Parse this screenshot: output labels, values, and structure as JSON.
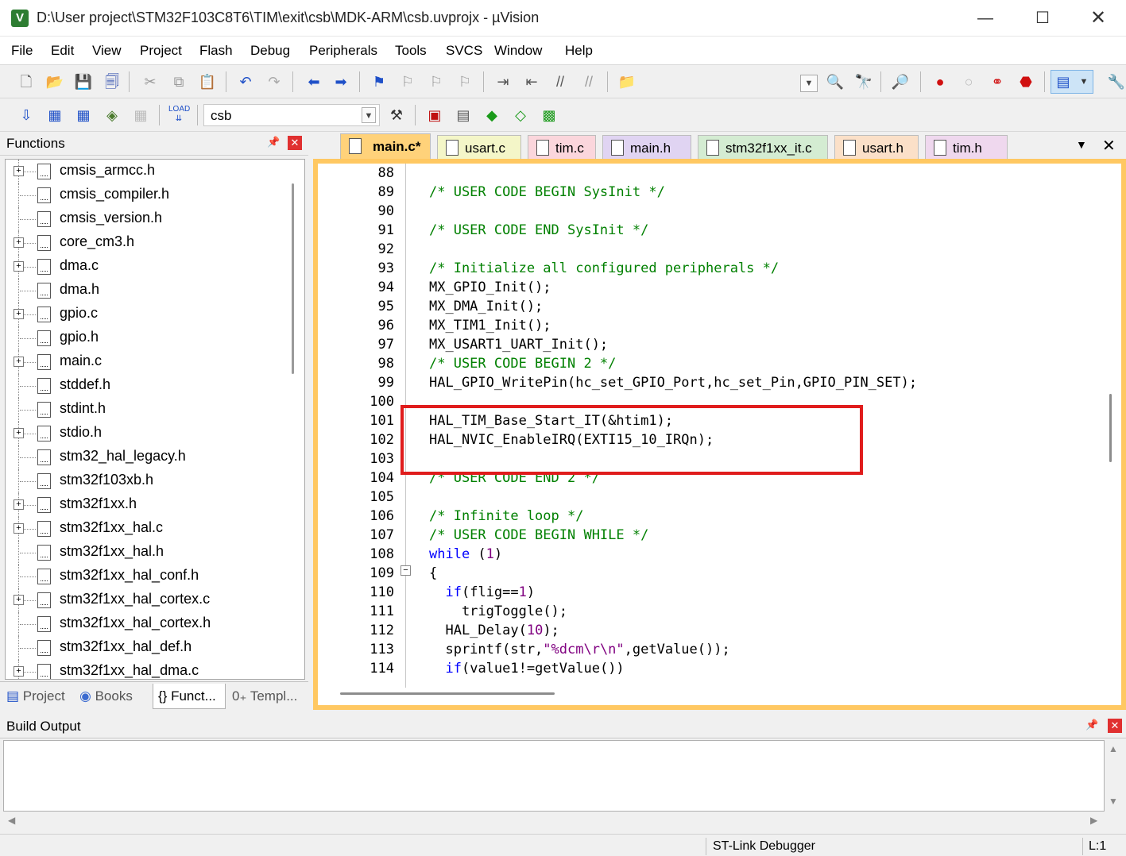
{
  "window": {
    "title": "D:\\User project\\STM32F103C8T6\\TIM\\exit\\csb\\MDK-ARM\\csb.uvprojx - µVision",
    "minimize": "—",
    "maximize": "☐",
    "close": "✕"
  },
  "menu": [
    "File",
    "Edit",
    "View",
    "Project",
    "Flash",
    "Debug",
    "Peripherals",
    "Tools",
    "SVCS",
    "Window",
    "Help"
  ],
  "toolbar": {
    "target": "csb",
    "icons_row1": [
      "new-file-icon",
      "open-file-icon",
      "save-icon",
      "save-all-icon",
      "cut-icon",
      "copy-icon",
      "paste-icon",
      "undo-icon",
      "redo-icon",
      "nav-back-icon",
      "nav-forward-icon",
      "bookmark-icon",
      "bookmark-prev-icon",
      "bookmark-next-icon",
      "bookmark-clear-icon",
      "indent-icon",
      "unindent-icon",
      "comment-icon",
      "uncomment-icon",
      "find-in-files-icon",
      "find-icon",
      "incremental-find-icon",
      "debug-session-icon",
      "breakpoint-icon",
      "disable-breakpoint-icon",
      "disable-all-breakpoints-icon",
      "kill-all-breakpoints-icon",
      "window-layout-icon",
      "configure-icon"
    ],
    "icons_row2": [
      "translate-icon",
      "build-icon",
      "rebuild-icon",
      "batch-build-icon",
      "stop-build-icon",
      "download-icon",
      "target-options-icon",
      "manage-components-icon",
      "select-packs-icon",
      "manage-rte-icon",
      "pack-installer-icon"
    ],
    "load_label": "LOAD"
  },
  "functions_panel": {
    "title": "Functions",
    "files": [
      {
        "name": "cmsis_armcc.h",
        "expandable": true
      },
      {
        "name": "cmsis_compiler.h",
        "expandable": false
      },
      {
        "name": "cmsis_version.h",
        "expandable": false
      },
      {
        "name": "core_cm3.h",
        "expandable": true
      },
      {
        "name": "dma.c",
        "expandable": true
      },
      {
        "name": "dma.h",
        "expandable": false
      },
      {
        "name": "gpio.c",
        "expandable": true
      },
      {
        "name": "gpio.h",
        "expandable": false
      },
      {
        "name": "main.c",
        "expandable": true
      },
      {
        "name": "stddef.h",
        "expandable": false
      },
      {
        "name": "stdint.h",
        "expandable": false
      },
      {
        "name": "stdio.h",
        "expandable": true
      },
      {
        "name": "stm32_hal_legacy.h",
        "expandable": false
      },
      {
        "name": "stm32f103xb.h",
        "expandable": false
      },
      {
        "name": "stm32f1xx.h",
        "expandable": true
      },
      {
        "name": "stm32f1xx_hal.c",
        "expandable": true
      },
      {
        "name": "stm32f1xx_hal.h",
        "expandable": false
      },
      {
        "name": "stm32f1xx_hal_conf.h",
        "expandable": false
      },
      {
        "name": "stm32f1xx_hal_cortex.c",
        "expandable": true
      },
      {
        "name": "stm32f1xx_hal_cortex.h",
        "expandable": false
      },
      {
        "name": "stm32f1xx_hal_def.h",
        "expandable": false
      },
      {
        "name": "stm32f1xx_hal_dma.c",
        "expandable": true
      }
    ],
    "tabs": [
      "Project",
      "Books",
      "{} Funct...",
      "0₊ Templ..."
    ]
  },
  "editor": {
    "tabs": [
      {
        "label": "main.c*",
        "active": true,
        "color": "#ffd27a"
      },
      {
        "label": "usart.c",
        "active": false,
        "color": "#f4f6c8"
      },
      {
        "label": "tim.c",
        "active": false,
        "color": "#fbd6dc"
      },
      {
        "label": "main.h",
        "active": false,
        "color": "#e0d4f2"
      },
      {
        "label": "stm32f1xx_it.c",
        "active": false,
        "color": "#d4ecd2"
      },
      {
        "label": "usart.h",
        "active": false,
        "color": "#fbe0c8"
      },
      {
        "label": "tim.h",
        "active": false,
        "color": "#efd8ee"
      }
    ],
    "lines": [
      {
        "n": "88",
        "segs": []
      },
      {
        "n": "89",
        "segs": [
          {
            "t": "/* USER CODE BEGIN SysInit */",
            "c": "com"
          }
        ]
      },
      {
        "n": "90",
        "segs": []
      },
      {
        "n": "91",
        "segs": [
          {
            "t": "/* USER CODE END SysInit */",
            "c": "com"
          }
        ]
      },
      {
        "n": "92",
        "segs": []
      },
      {
        "n": "93",
        "segs": [
          {
            "t": "/* Initialize all configured peripherals */",
            "c": "com"
          }
        ]
      },
      {
        "n": "94",
        "segs": [
          {
            "t": "MX_GPIO_Init();",
            "c": ""
          }
        ]
      },
      {
        "n": "95",
        "segs": [
          {
            "t": "MX_DMA_Init();",
            "c": ""
          }
        ]
      },
      {
        "n": "96",
        "segs": [
          {
            "t": "MX_TIM1_Init();",
            "c": ""
          }
        ]
      },
      {
        "n": "97",
        "segs": [
          {
            "t": "MX_USART1_UART_Init();",
            "c": ""
          }
        ]
      },
      {
        "n": "98",
        "segs": [
          {
            "t": "/* USER CODE BEGIN 2 */",
            "c": "com"
          }
        ]
      },
      {
        "n": "99",
        "segs": [
          {
            "t": "HAL_GPIO_WritePin(hc_set_GPIO_Port,hc_set_Pin,GPIO_PIN_SET);",
            "c": ""
          }
        ]
      },
      {
        "n": "100",
        "segs": []
      },
      {
        "n": "101",
        "segs": [
          {
            "t": "HAL_TIM_Base_Start_IT(&htim1);",
            "c": ""
          }
        ]
      },
      {
        "n": "102",
        "segs": [
          {
            "t": "HAL_NVIC_EnableIRQ(EXTI15_10_IRQn);",
            "c": ""
          }
        ]
      },
      {
        "n": "103",
        "segs": []
      },
      {
        "n": "104",
        "segs": [
          {
            "t": "/* USER CODE END 2 */",
            "c": "com"
          }
        ]
      },
      {
        "n": "105",
        "segs": []
      },
      {
        "n": "106",
        "segs": [
          {
            "t": "/* Infinite loop */",
            "c": "com"
          }
        ]
      },
      {
        "n": "107",
        "segs": [
          {
            "t": "/* USER CODE BEGIN WHILE */",
            "c": "com"
          }
        ]
      },
      {
        "n": "108",
        "segs": [
          {
            "t": "while",
            "c": "kw"
          },
          {
            "t": " (",
            "c": ""
          },
          {
            "t": "1",
            "c": "num"
          },
          {
            "t": ")",
            "c": ""
          }
        ]
      },
      {
        "n": "109",
        "segs": [
          {
            "t": "{",
            "c": ""
          }
        ]
      },
      {
        "n": "110",
        "segs": [
          {
            "t": "  ",
            "c": ""
          },
          {
            "t": "if",
            "c": "kw"
          },
          {
            "t": "(flig==",
            "c": ""
          },
          {
            "t": "1",
            "c": "num"
          },
          {
            "t": ")",
            "c": ""
          }
        ]
      },
      {
        "n": "111",
        "segs": [
          {
            "t": "    trigToggle();",
            "c": ""
          }
        ]
      },
      {
        "n": "112",
        "segs": [
          {
            "t": "  HAL_Delay(",
            "c": ""
          },
          {
            "t": "10",
            "c": "num"
          },
          {
            "t": ");",
            "c": ""
          }
        ]
      },
      {
        "n": "113",
        "segs": [
          {
            "t": "  sprintf(str,",
            "c": ""
          },
          {
            "t": "\"%dcm\\r\\n\"",
            "c": "str"
          },
          {
            "t": ",getValue());",
            "c": ""
          }
        ]
      },
      {
        "n": "114",
        "segs": [
          {
            "t": "  ",
            "c": ""
          },
          {
            "t": "if",
            "c": "kw"
          },
          {
            "t": "(value1!=getValue())",
            "c": ""
          }
        ]
      }
    ]
  },
  "build_output": {
    "title": "Build Output"
  },
  "status": {
    "debugger": "ST-Link Debugger",
    "position": "L:1"
  }
}
